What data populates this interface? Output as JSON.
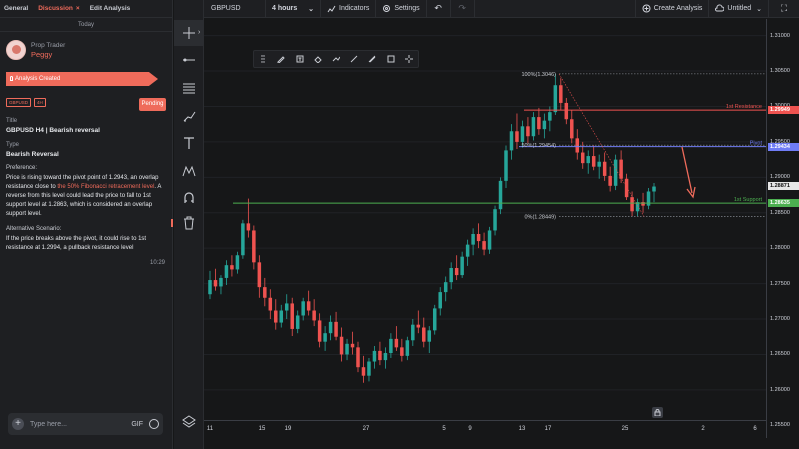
{
  "left_panel": {
    "tabs": [
      {
        "label": "General"
      },
      {
        "label": "Discussion",
        "close": "×"
      },
      {
        "label": "Edit Analysis"
      }
    ],
    "date_separator": "Today",
    "author": {
      "role": "Prop Trader",
      "name": "Peggy"
    },
    "status_banner": "Analysis Created",
    "tags": [
      "GBPUSD",
      "4H"
    ],
    "status_button": "Pending",
    "title_label": "Title",
    "title_value": "GBPUSD H4 | Bearish reversal",
    "type_label": "Type",
    "type_value": "Bearish Reversal",
    "preference_label": "Preference:",
    "preference_text_1": "Price is rising toward the pivot point of 1.2943, an overlap resistance close to ",
    "preference_highlight": "the 50% Fibonacci retracement level",
    "preference_text_2": ". A reverse from this level could lead the price to fall to 1st support level at 1.2863, which is considered an overlap support level.",
    "alt_label": "Alternative Scenario:",
    "alt_text": "If the price breaks above the pivot, it could rise to 1st resistance at 1.2994, a pullback resistance level",
    "timestamp": "10:29",
    "composer": {
      "placeholder": "Type here...",
      "gif_label": "GIF"
    }
  },
  "toolbar": {
    "symbol": "GBPUSD",
    "timeframe": "4 hours",
    "indicators": "Indicators",
    "settings": "Settings",
    "create_analysis": "Create Analysis",
    "layout_name": "Untitled"
  },
  "tools": [
    "crosshair-icon",
    "horizontal-line-icon",
    "fib-retracement-icon",
    "brush-icon",
    "text-icon",
    "pattern-icon",
    "magnet-icon",
    "trash-icon",
    "layers-icon"
  ],
  "drawing_toolbar": [
    "drag-handle-icon",
    "pencil-icon",
    "text-box-icon",
    "fill-icon",
    "style-icon",
    "line-icon",
    "clone-icon",
    "rect-icon",
    "crosshair-icon"
  ],
  "chart_data": {
    "type": "candlestick",
    "symbol": "GBPUSD",
    "timeframe": "4 hours",
    "ylim": [
      1.2549,
      1.3115
    ],
    "y_ticks": [
      "1.31000",
      "1.30500",
      "1.30000",
      "1.29500",
      "1.29000",
      "1.28500",
      "1.28000",
      "1.27500",
      "1.27000",
      "1.26500",
      "1.26000",
      "1.25500"
    ],
    "x_ticks": [
      "11",
      "15",
      "19",
      "27",
      "5",
      "9",
      "13",
      "17",
      "25",
      "2",
      "6"
    ],
    "levels": [
      {
        "label": "1st Resistance",
        "price": 1.29949,
        "price_label": "1.29949",
        "color": "#ef5350"
      },
      {
        "label": "Pivot",
        "price": 1.29434,
        "price_label": "1.29434",
        "color": "#6f7cf5"
      },
      {
        "label": "1st Support",
        "price": 1.28635,
        "price_label": "1.28635",
        "color": "#4caf50"
      }
    ],
    "current_price": {
      "price": 1.28871,
      "label": "1.28871",
      "color": "#e6e6e6"
    },
    "fibonacci": [
      {
        "label": "100%(1.3046)",
        "price": 1.3046
      },
      {
        "label": "50%(1.29454)",
        "price": 1.29454
      },
      {
        "label": "0%(1.28449)",
        "price": 1.28449
      }
    ],
    "up_color": "#26a69a",
    "down_color": "#ef5350",
    "candles": [
      [
        1.2735,
        1.2768,
        1.2728,
        1.2755
      ],
      [
        1.2755,
        1.2771,
        1.274,
        1.2746
      ],
      [
        1.2746,
        1.2762,
        1.2735,
        1.2758
      ],
      [
        1.2758,
        1.2783,
        1.2748,
        1.2776
      ],
      [
        1.2776,
        1.279,
        1.276,
        1.277
      ],
      [
        1.277,
        1.2795,
        1.2764,
        1.279
      ],
      [
        1.279,
        1.284,
        1.2785,
        1.2835
      ],
      [
        1.2835,
        1.287,
        1.2815,
        1.2825
      ],
      [
        1.2825,
        1.2832,
        1.277,
        1.278
      ],
      [
        1.278,
        1.279,
        1.273,
        1.2745
      ],
      [
        1.2745,
        1.2758,
        1.2718,
        1.273
      ],
      [
        1.273,
        1.2742,
        1.27,
        1.2712
      ],
      [
        1.2712,
        1.2728,
        1.2685,
        1.2695
      ],
      [
        1.2695,
        1.272,
        1.2688,
        1.2712
      ],
      [
        1.2712,
        1.2735,
        1.27,
        1.2722
      ],
      [
        1.2722,
        1.273,
        1.2676,
        1.2686
      ],
      [
        1.2686,
        1.2712,
        1.268,
        1.2705
      ],
      [
        1.2705,
        1.273,
        1.2698,
        1.2725
      ],
      [
        1.2725,
        1.274,
        1.2705,
        1.2712
      ],
      [
        1.2712,
        1.2728,
        1.269,
        1.2698
      ],
      [
        1.2698,
        1.2708,
        1.266,
        1.2668
      ],
      [
        1.2668,
        1.269,
        1.2655,
        1.268
      ],
      [
        1.268,
        1.2705,
        1.267,
        1.2696
      ],
      [
        1.2696,
        1.271,
        1.267,
        1.2675
      ],
      [
        1.2675,
        1.2688,
        1.264,
        1.265
      ],
      [
        1.265,
        1.2672,
        1.2642,
        1.2665
      ],
      [
        1.2665,
        1.2682,
        1.265,
        1.266
      ],
      [
        1.266,
        1.2668,
        1.2625,
        1.2632
      ],
      [
        1.2632,
        1.2648,
        1.261,
        1.262
      ],
      [
        1.262,
        1.2645,
        1.2612,
        1.264
      ],
      [
        1.264,
        1.2662,
        1.263,
        1.2655
      ],
      [
        1.2655,
        1.2668,
        1.2635,
        1.2642
      ],
      [
        1.2642,
        1.266,
        1.263,
        1.2652
      ],
      [
        1.2652,
        1.268,
        1.2645,
        1.2672
      ],
      [
        1.2672,
        1.269,
        1.2655,
        1.266
      ],
      [
        1.266,
        1.2672,
        1.264,
        1.2648
      ],
      [
        1.2648,
        1.2675,
        1.2642,
        1.267
      ],
      [
        1.267,
        1.27,
        1.2662,
        1.2692
      ],
      [
        1.2692,
        1.2712,
        1.268,
        1.2688
      ],
      [
        1.2688,
        1.2702,
        1.266,
        1.2668
      ],
      [
        1.2668,
        1.269,
        1.2652,
        1.2684
      ],
      [
        1.2684,
        1.272,
        1.2678,
        1.2715
      ],
      [
        1.2715,
        1.2745,
        1.2705,
        1.2738
      ],
      [
        1.2738,
        1.276,
        1.2725,
        1.2752
      ],
      [
        1.2752,
        1.278,
        1.2742,
        1.2772
      ],
      [
        1.2772,
        1.279,
        1.2755,
        1.2762
      ],
      [
        1.2762,
        1.2795,
        1.2758,
        1.2788
      ],
      [
        1.2788,
        1.2812,
        1.2775,
        1.2805
      ],
      [
        1.2805,
        1.2828,
        1.279,
        1.282
      ],
      [
        1.282,
        1.2835,
        1.28,
        1.281
      ],
      [
        1.281,
        1.2822,
        1.279,
        1.2798
      ],
      [
        1.2798,
        1.283,
        1.2792,
        1.2825
      ],
      [
        1.2825,
        1.286,
        1.2818,
        1.2855
      ],
      [
        1.2855,
        1.29,
        1.2848,
        1.2895
      ],
      [
        1.2895,
        1.2945,
        1.2885,
        1.2938
      ],
      [
        1.2938,
        1.2975,
        1.2925,
        1.2965
      ],
      [
        1.2965,
        1.299,
        1.294,
        1.295
      ],
      [
        1.295,
        1.298,
        1.2942,
        1.2972
      ],
      [
        1.2972,
        1.2985,
        1.2948,
        1.2958
      ],
      [
        1.2958,
        1.2992,
        1.2952,
        1.2985
      ],
      [
        1.2985,
        1.2998,
        1.296,
        1.2968
      ],
      [
        1.2968,
        1.299,
        1.2955,
        1.298
      ],
      [
        1.298,
        1.3,
        1.2965,
        1.2992
      ],
      [
        1.2992,
        1.3046,
        1.2988,
        1.303
      ],
      [
        1.303,
        1.304,
        1.2995,
        1.3005
      ],
      [
        1.3005,
        1.3012,
        1.2975,
        1.2982
      ],
      [
        1.2982,
        1.2995,
        1.2948,
        1.2955
      ],
      [
        1.2955,
        1.2968,
        1.2925,
        1.2935
      ],
      [
        1.2935,
        1.295,
        1.2912,
        1.292
      ],
      [
        1.292,
        1.2938,
        1.2905,
        1.293
      ],
      [
        1.293,
        1.2945,
        1.291,
        1.2915
      ],
      [
        1.2915,
        1.2932,
        1.2898,
        1.2922
      ],
      [
        1.2922,
        1.2935,
        1.2895,
        1.2902
      ],
      [
        1.2902,
        1.2915,
        1.288,
        1.2888
      ],
      [
        1.2888,
        1.2932,
        1.2882,
        1.2925
      ],
      [
        1.2925,
        1.2938,
        1.2892,
        1.2898
      ],
      [
        1.2898,
        1.2905,
        1.2868,
        1.2872
      ],
      [
        1.2872,
        1.288,
        1.2845,
        1.2852
      ],
      [
        1.2852,
        1.287,
        1.2845,
        1.2865
      ],
      [
        1.2865,
        1.2878,
        1.285,
        1.286
      ],
      [
        1.286,
        1.2885,
        1.2855,
        1.288
      ],
      [
        1.288,
        1.2892,
        1.2865,
        1.2887
      ]
    ]
  }
}
